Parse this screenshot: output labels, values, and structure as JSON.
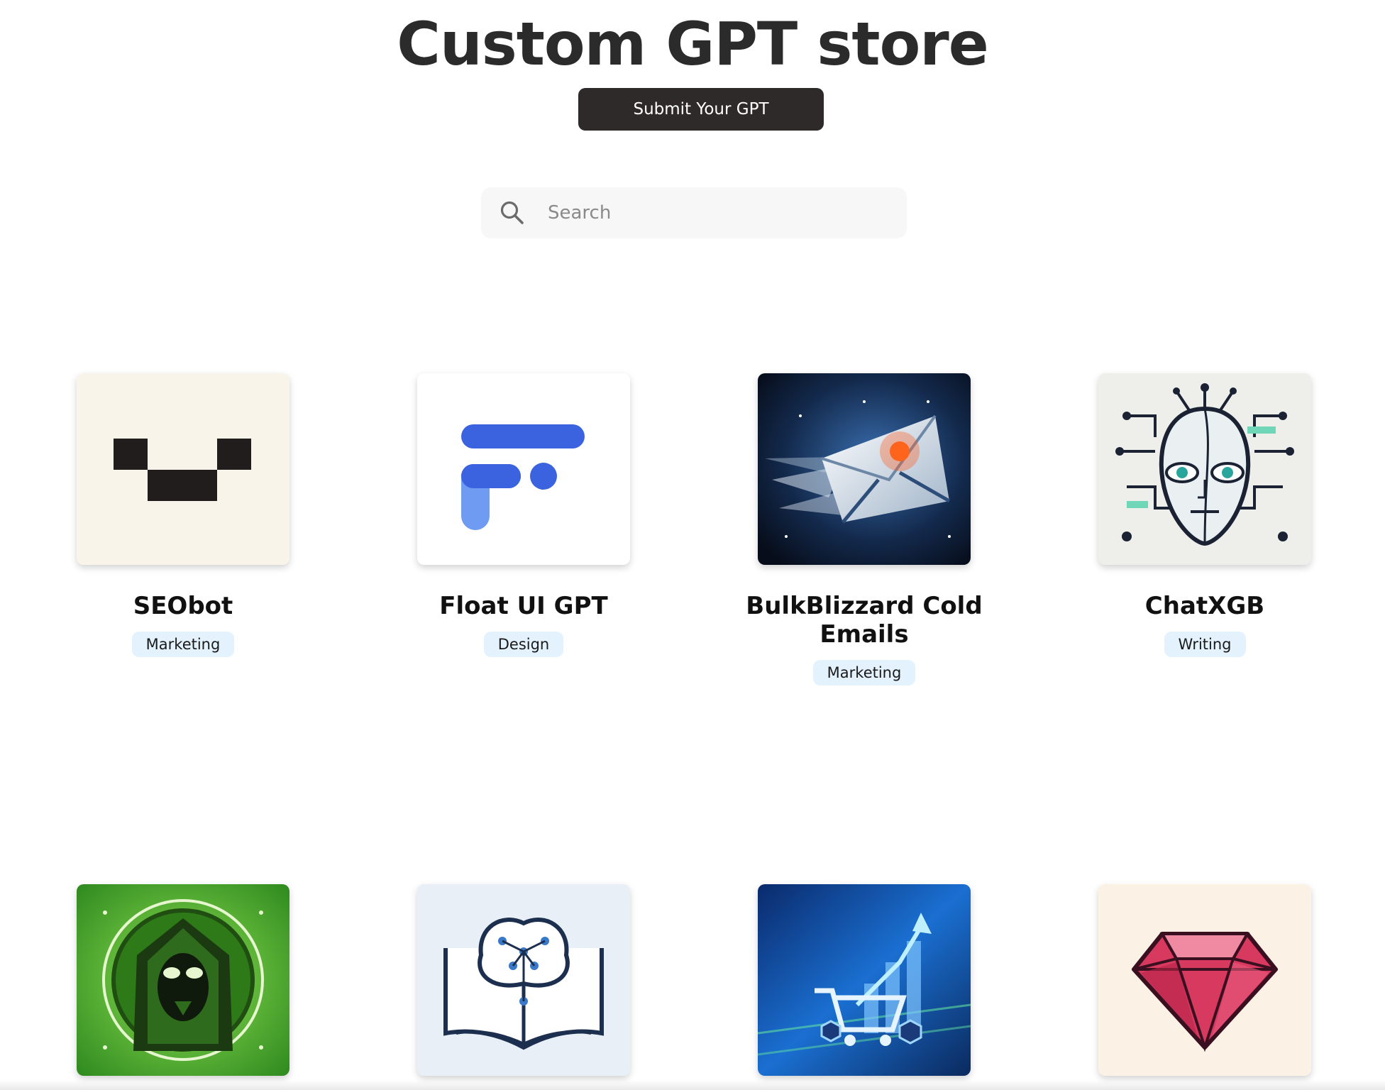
{
  "header": {
    "title": "Custom GPT store",
    "submit_label": "Submit Your GPT"
  },
  "search": {
    "placeholder": "Search",
    "value": ""
  },
  "colors": {
    "title": "#2b2b2b",
    "submit_button_bg": "#2e2a2a",
    "badge_bg": "#e3f2fc",
    "search_bg": "#f7f7f7"
  },
  "gpts": [
    {
      "name": "SEObot",
      "category": "Marketing",
      "icon": "pixel-smile-icon"
    },
    {
      "name": "Float UI GPT",
      "category": "Design",
      "icon": "float-ui-logo-icon"
    },
    {
      "name": "BulkBlizzard Cold Emails",
      "category": "Marketing",
      "icon": "blizzard-envelope-icon"
    },
    {
      "name": "ChatXGB",
      "category": "Writing",
      "icon": "circuit-face-icon"
    },
    {
      "name": "",
      "category": "",
      "icon": "hooded-hacker-icon"
    },
    {
      "name": "",
      "category": "",
      "icon": "brain-book-icon"
    },
    {
      "name": "",
      "category": "",
      "icon": "ecommerce-cart-chart-icon"
    },
    {
      "name": "",
      "category": "",
      "icon": "ruby-gem-icon"
    }
  ]
}
